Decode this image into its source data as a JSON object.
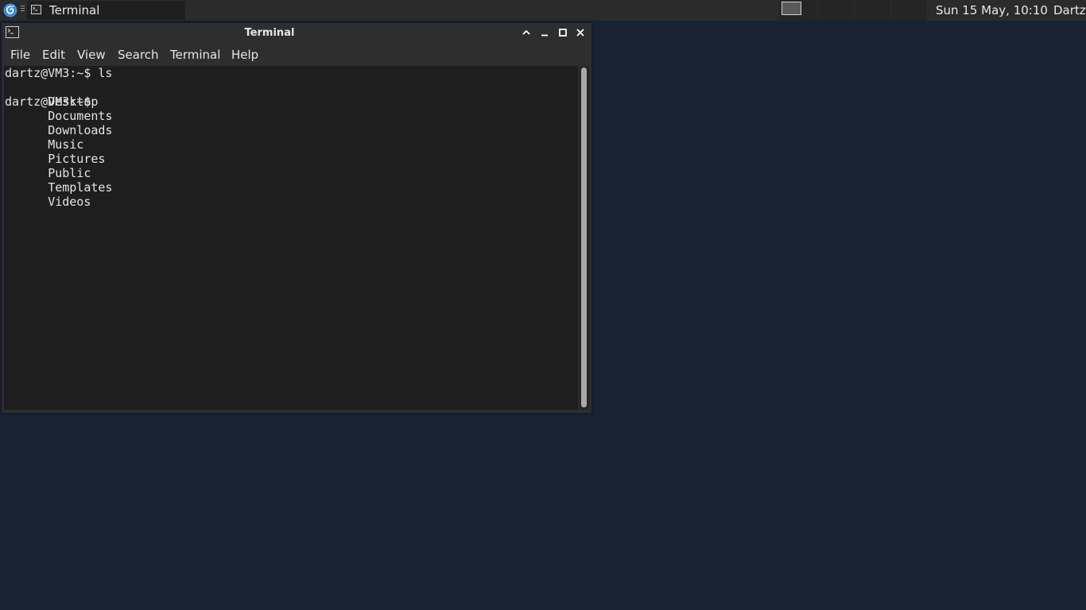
{
  "panel": {
    "app_menu_icon": "debian-swirl-icon",
    "taskbar": [
      {
        "label": "Terminal",
        "icon": "terminal-icon"
      }
    ],
    "workspaces": 4,
    "clock": "Sun 15 May, 10:10",
    "user": "Dartz"
  },
  "window": {
    "title": "Terminal",
    "icon": "terminal-icon",
    "controls": [
      "shade-icon",
      "minimize-icon",
      "maximize-icon",
      "close-icon"
    ],
    "menu": [
      "File",
      "Edit",
      "View",
      "Search",
      "Terminal",
      "Help"
    ]
  },
  "terminal": {
    "line1": "dartz@VM3:~$ ls",
    "listing": [
      "Desktop",
      "Documents",
      "Downloads",
      "Music",
      "Pictures",
      "Public",
      "Templates",
      "Videos"
    ],
    "line3": "dartz@VM3:~$ "
  },
  "colors": {
    "desktop": "#182233",
    "panel": "#2b2b2b",
    "window_chrome": "#2e2e2e",
    "terminal_bg": "#1e1e1e",
    "terminal_fg": "#e4e4e4",
    "app_menu_accent": "#3d8fd8"
  }
}
